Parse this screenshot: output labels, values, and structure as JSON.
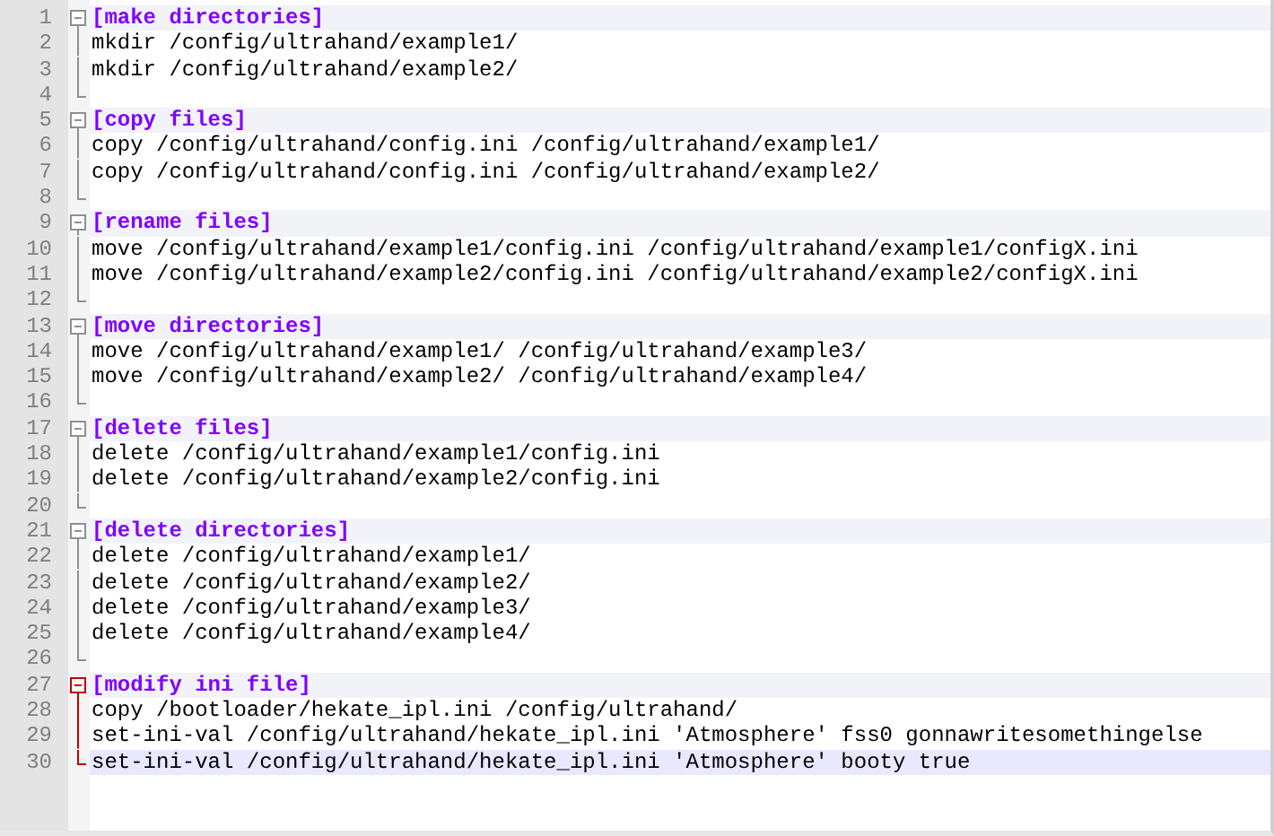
{
  "editor": {
    "sections": [
      {
        "header": {
          "number": "1",
          "text": "[make directories]"
        },
        "expanded": true,
        "selected": false,
        "lines": [
          {
            "number": "2",
            "text": "mkdir /config/ultrahand/example1/",
            "current": false
          },
          {
            "number": "3",
            "text": "mkdir /config/ultrahand/example2/",
            "current": false
          }
        ],
        "end_number": "4"
      },
      {
        "header": {
          "number": "5",
          "text": "[copy files]"
        },
        "expanded": true,
        "selected": false,
        "lines": [
          {
            "number": "6",
            "text": "copy /config/ultrahand/config.ini /config/ultrahand/example1/",
            "current": false
          },
          {
            "number": "7",
            "text": "copy /config/ultrahand/config.ini /config/ultrahand/example2/",
            "current": false
          }
        ],
        "end_number": "8"
      },
      {
        "header": {
          "number": "9",
          "text": "[rename files]"
        },
        "expanded": true,
        "selected": false,
        "lines": [
          {
            "number": "10",
            "text": "move /config/ultrahand/example1/config.ini /config/ultrahand/example1/configX.ini",
            "current": false
          },
          {
            "number": "11",
            "text": "move /config/ultrahand/example2/config.ini /config/ultrahand/example2/configX.ini",
            "current": false
          }
        ],
        "end_number": "12"
      },
      {
        "header": {
          "number": "13",
          "text": "[move directories]"
        },
        "expanded": true,
        "selected": false,
        "lines": [
          {
            "number": "14",
            "text": "move /config/ultrahand/example1/ /config/ultrahand/example3/",
            "current": false
          },
          {
            "number": "15",
            "text": "move /config/ultrahand/example2/ /config/ultrahand/example4/",
            "current": false
          }
        ],
        "end_number": "16"
      },
      {
        "header": {
          "number": "17",
          "text": "[delete files]"
        },
        "expanded": true,
        "selected": false,
        "lines": [
          {
            "number": "18",
            "text": "delete /config/ultrahand/example1/config.ini",
            "current": false
          },
          {
            "number": "19",
            "text": "delete /config/ultrahand/example2/config.ini",
            "current": false
          }
        ],
        "end_number": "20"
      },
      {
        "header": {
          "number": "21",
          "text": "[delete directories]"
        },
        "expanded": true,
        "selected": false,
        "lines": [
          {
            "number": "22",
            "text": "delete /config/ultrahand/example1/",
            "current": false
          },
          {
            "number": "23",
            "text": "delete /config/ultrahand/example2/",
            "current": false
          },
          {
            "number": "24",
            "text": "delete /config/ultrahand/example3/",
            "current": false
          },
          {
            "number": "25",
            "text": "delete /config/ultrahand/example4/",
            "current": false
          }
        ],
        "end_number": "26"
      },
      {
        "header": {
          "number": "27",
          "text": "[modify ini file]"
        },
        "expanded": true,
        "selected": true,
        "lines": [
          {
            "number": "28",
            "text": "copy /bootloader/hekate_ipl.ini /config/ultrahand/",
            "current": false
          },
          {
            "number": "29",
            "text": "set-ini-val /config/ultrahand/hekate_ipl.ini 'Atmosphere' fss0 gonnawritesomethingelse",
            "current": false
          },
          {
            "number": "30",
            "text": "set-ini-val /config/ultrahand/hekate_ipl.ini 'Atmosphere' booty true",
            "current": true
          }
        ]
      }
    ]
  }
}
